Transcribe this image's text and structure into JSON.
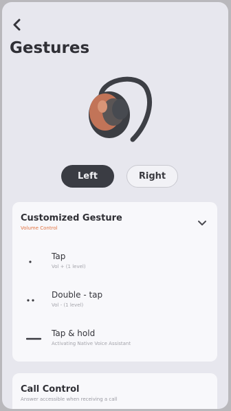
{
  "header": {
    "title": "Gestures",
    "back_icon": "chevron-left-icon"
  },
  "earbud_side": {
    "options": [
      "Left",
      "Right"
    ],
    "selected": "Left"
  },
  "customized_gesture": {
    "title": "Customized Gesture",
    "subtitle": "Volume Control",
    "expand_icon": "chevron-down-icon",
    "items": [
      {
        "icon": "single-dot-icon",
        "label": "Tap",
        "desc": "Vol + (1 level)"
      },
      {
        "icon": "double-dot-icon",
        "label": "Double - tap",
        "desc": "Vol - (1 level)"
      },
      {
        "icon": "dash-icon",
        "label": "Tap & hold",
        "desc": "Activating Native Voice Assistant"
      }
    ]
  },
  "call_control": {
    "title": "Call Control",
    "subtitle": "Answer accessible when receiving a call"
  },
  "colors": {
    "accent": "#e27341",
    "pill_dark": "#3a3c43",
    "background": "#e7e7ee"
  }
}
